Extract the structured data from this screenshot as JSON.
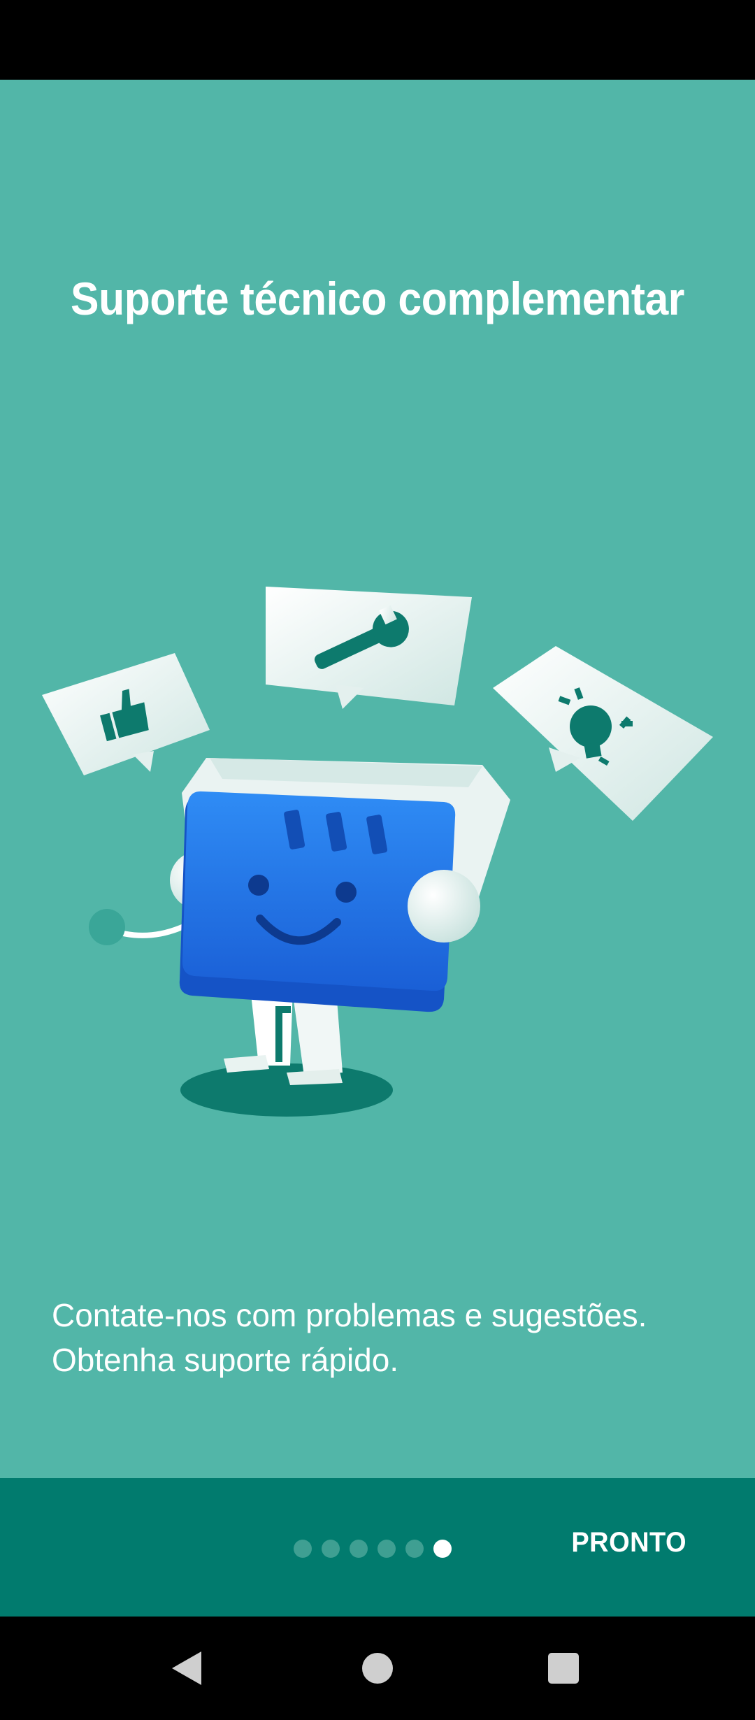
{
  "onboarding": {
    "title": "Suporte técnico complementar",
    "description_lines": [
      "Contate-nos com problemas e sugestões.",
      "Obtenha suporte rápido."
    ],
    "illustration_icons": [
      "thumbs-up-icon",
      "wrench-icon",
      "lightbulb-icon"
    ],
    "pager": {
      "total_pages": 6,
      "current_page": 6
    },
    "done_label": "PRONTO"
  },
  "colors": {
    "background": "#52b6a8",
    "bottom_bar": "#017b6e",
    "dot_inactive": "#3f9f92",
    "dot_active": "#ffffff",
    "mascot_blue": "#1e73e6"
  },
  "navigation": {
    "icons": [
      "back-icon",
      "home-icon",
      "recents-icon"
    ]
  }
}
